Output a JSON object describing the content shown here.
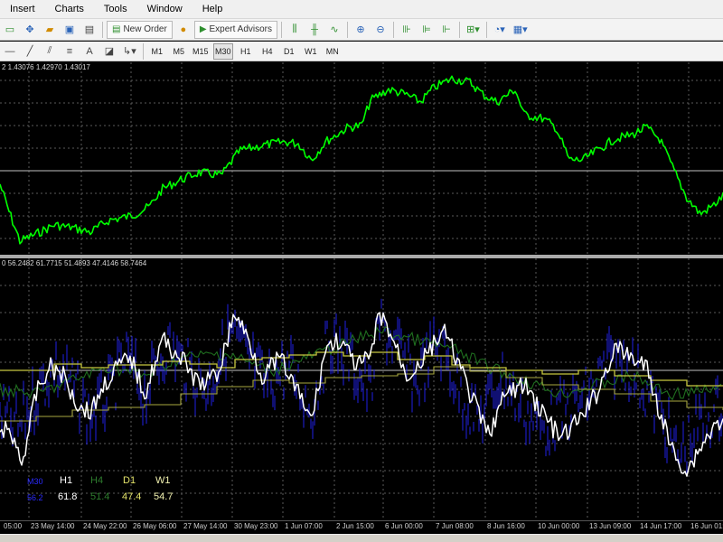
{
  "menu": {
    "items": [
      "Insert",
      "Charts",
      "Tools",
      "Window",
      "Help"
    ]
  },
  "toolbar": {
    "new_order_label": "New Order",
    "expert_advisors_label": "Expert Advisors",
    "timeframes": [
      "M1",
      "M5",
      "M15",
      "M30",
      "H1",
      "H4",
      "D1",
      "W1",
      "MN"
    ],
    "active_timeframe": "M30"
  },
  "main_chart": {
    "header": "2 1.43076 1.42970 1.43017",
    "line_color": "#00ff00"
  },
  "indicator": {
    "header": "0 56.2482 61.7715 51.4893 47.4146 58.7464",
    "legend": {
      "labels": [
        "H1",
        "H4",
        "D1",
        "W1"
      ],
      "values": [
        "61.8",
        "51.4",
        "47.4",
        "54.7"
      ],
      "colors": {
        "blue_series": "#2020e0",
        "white_series": "#ffffff",
        "green_series": "#1f6f1f",
        "yellow_series": "#c8c840"
      }
    }
  },
  "time_axis": {
    "labels": [
      "05:00",
      "23 May 14:00",
      "24 May 22:00",
      "26 May 06:00",
      "27 May 14:00",
      "30 May 23:00",
      "1 Jun 07:00",
      "2 Jun 15:00",
      "6 Jun 00:00",
      "7 Jun 08:00",
      "8 Jun 16:00",
      "10 Jun 00:00",
      "13 Jun 09:00",
      "14 Jun 17:00",
      "16 Jun 01:"
    ]
  },
  "colors": {
    "chart_background": "#000000",
    "grid": "#5a5a5a",
    "main_line": "#00ff00"
  }
}
